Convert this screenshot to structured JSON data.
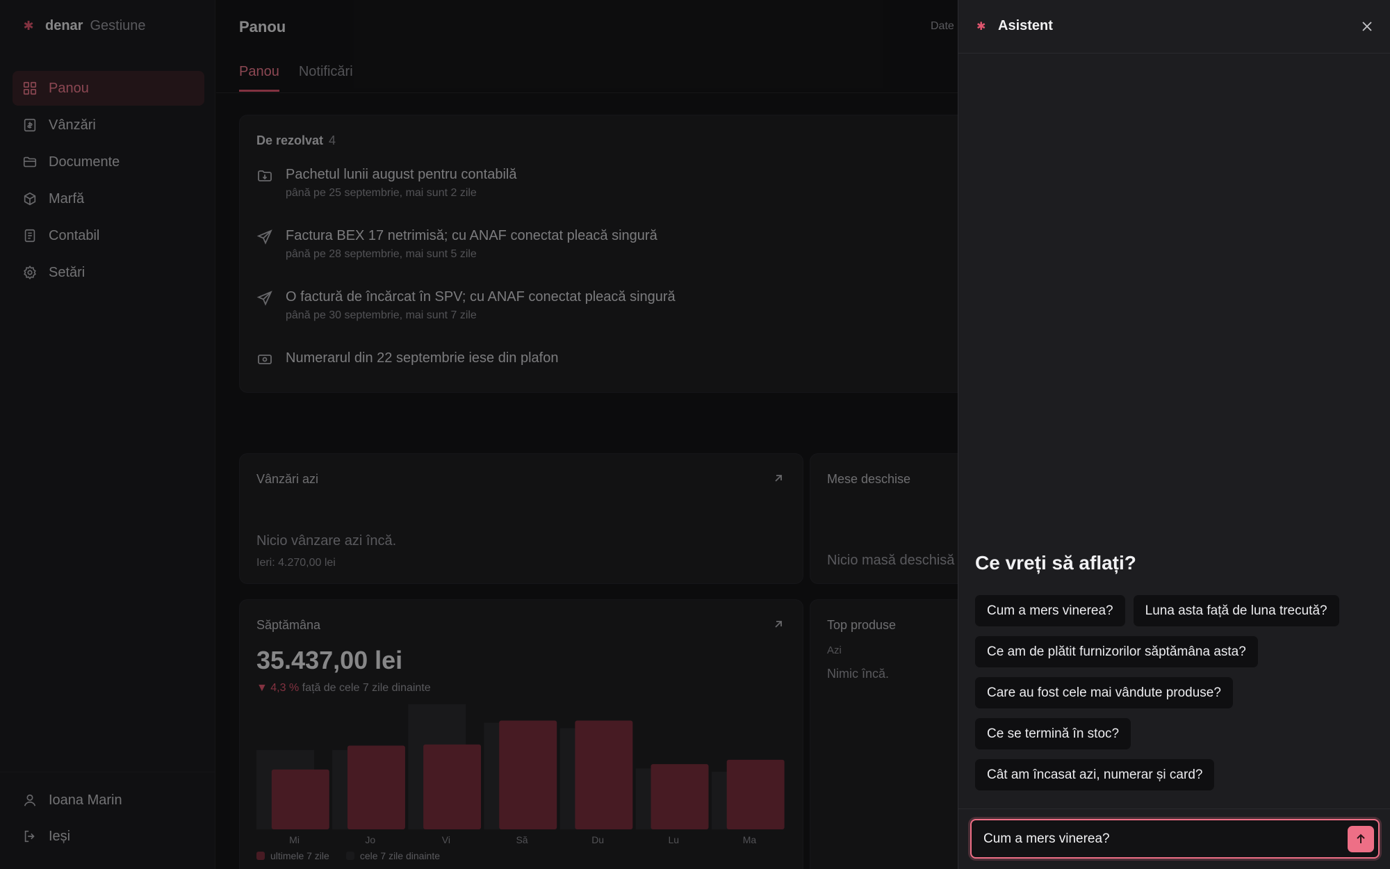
{
  "brand": {
    "name": "denar",
    "product": "Gestiune"
  },
  "sidebar": {
    "items": [
      {
        "label": "Panou",
        "icon": "dashboard-icon",
        "active": true
      },
      {
        "label": "Vânzări",
        "icon": "receipt-icon"
      },
      {
        "label": "Documente",
        "icon": "folder-icon"
      },
      {
        "label": "Marfă",
        "icon": "box-icon"
      },
      {
        "label": "Contabil",
        "icon": "ledger-icon"
      },
      {
        "label": "Setări",
        "icon": "gear-icon"
      }
    ],
    "user": "Ioana Marin",
    "logout": "Ieși"
  },
  "header": {
    "title": "Panou",
    "right_text": "Date"
  },
  "tabs": [
    {
      "label": "Panou",
      "active": true
    },
    {
      "label": "Notificări"
    }
  ],
  "todo": {
    "title": "De rezolvat",
    "count": "4",
    "items": [
      {
        "title": "Pachetul lunii august pentru contabilă",
        "sub": "până pe 25 septembrie, mai sunt 2 zile",
        "icon": "folder-download-icon"
      },
      {
        "title": "Factura BEX 17 netrimisă; cu ANAF conectat pleacă singură",
        "sub": "până pe 28 septembrie, mai sunt 5 zile",
        "icon": "send-icon"
      },
      {
        "title": "O factură de încărcat în SPV; cu ANAF conectat pleacă singură",
        "sub": "până pe 30 septembrie, mai sunt 7 zile",
        "icon": "send-icon"
      },
      {
        "title": "Numerarul din 22 septembrie iese din plafon",
        "sub": "",
        "icon": "cash-icon"
      }
    ]
  },
  "sales_today": {
    "title": "Vânzări azi",
    "empty": "Nicio vânzare azi încă.",
    "yesterday": "Ieri: 4.270,00 lei"
  },
  "open_tables": {
    "title": "Mese deschise",
    "empty": "Nicio masă deschisă"
  },
  "week": {
    "title": "Săptămâna",
    "total": "35.437,00 lei",
    "delta_value": "▼ 4,3 %",
    "delta_text": " față de cele 7 zile dinainte",
    "legend_current": "ultimele 7 zile",
    "legend_previous": "cele 7 zile dinainte"
  },
  "top_products": {
    "title": "Top produse",
    "period": "Azi",
    "empty": "Nimic încă."
  },
  "chart_data": {
    "type": "bar",
    "categories": [
      "Mi",
      "Jo",
      "Vi",
      "Să",
      "Du",
      "Lu",
      "Ma"
    ],
    "series": [
      {
        "name": "ultimele 7 zile",
        "values": [
          0.55,
          0.77,
          0.78,
          1.0,
          1.0,
          0.6,
          0.64
        ],
        "color": "#7a2f3d"
      },
      {
        "name": "cele 7 zile dinainte",
        "values": [
          0.73,
          0.73,
          1.15,
          0.98,
          0.93,
          0.56,
          0.53
        ],
        "color": "#2b2b2f"
      }
    ],
    "ylim": [
      0,
      1.15
    ]
  },
  "assistant": {
    "title": "Asistent",
    "question": "Ce vreți să aflați?",
    "suggestions": [
      "Cum a mers vinerea?",
      "Luna asta față de luna trecută?",
      "Ce am de plătit furnizorilor săptămâna asta?",
      "Care au fost cele mai vândute produse?",
      "Ce se termină în stoc?",
      "Cât am încasat azi, numerar și card?"
    ],
    "input_value": "Cum a mers vinerea?"
  },
  "colors": {
    "accent": "#ee6f86",
    "accent_dark": "#e0566f",
    "background": "#161618",
    "drawer": "#1d1d20"
  }
}
